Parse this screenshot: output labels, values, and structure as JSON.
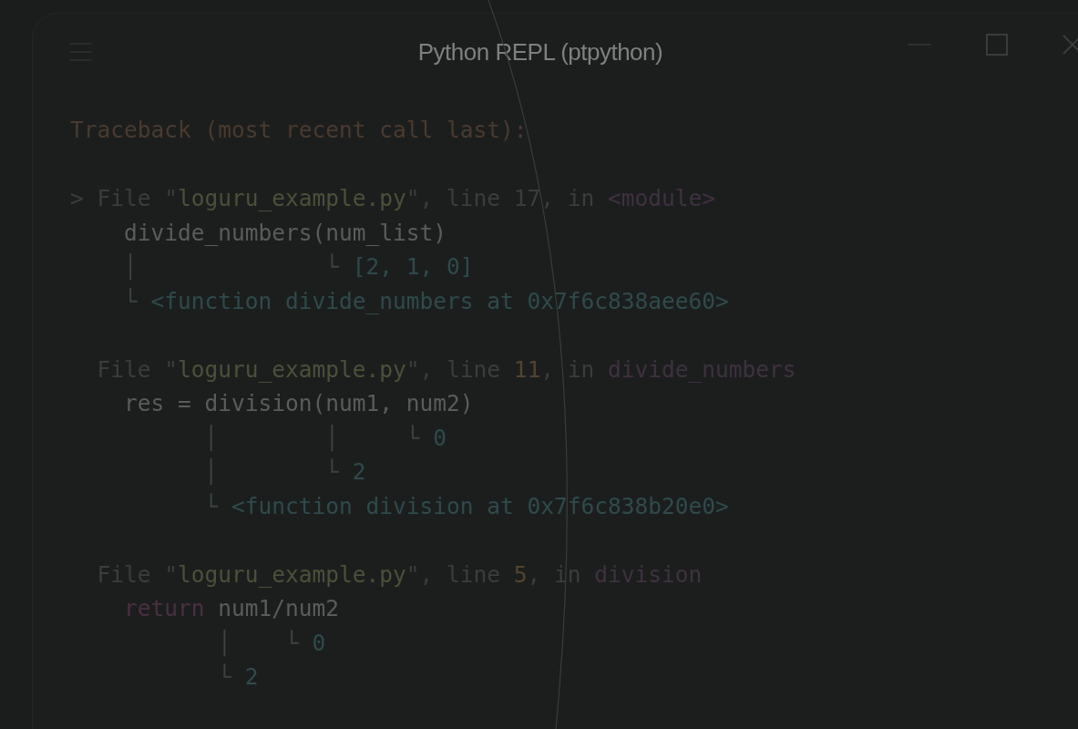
{
  "window": {
    "title": "Python REPL (ptpython)"
  },
  "traceback": {
    "header": "Traceback (most recent call last):",
    "frames": [
      {
        "lines": [
          [
            {
              "t": "> File \"",
              "kind": "dim"
            },
            {
              "t": "loguru_example.py",
              "kind": "path"
            },
            {
              "t": "\", line ",
              "kind": "dim"
            },
            {
              "t": "17",
              "kind": "dim"
            },
            {
              "t": ", in ",
              "kind": "dim"
            },
            {
              "t": "<module>",
              "kind": "func"
            }
          ],
          [
            {
              "t": "    divide_numbers(num_list)",
              "kind": "code"
            }
          ],
          [
            {
              "t": "    │              └ ",
              "kind": "tree"
            },
            {
              "t": "[2, 1, 0]",
              "kind": "value"
            }
          ],
          [
            {
              "t": "    └ ",
              "kind": "tree"
            },
            {
              "t": "<function divide_numbers at 0x7f6c838aee60>",
              "kind": "value"
            }
          ]
        ]
      },
      {
        "lines": [
          [
            {
              "t": "  File \"",
              "kind": "dim"
            },
            {
              "t": "loguru_example.py",
              "kind": "path"
            },
            {
              "t": "\", line ",
              "kind": "dim"
            },
            {
              "t": "11",
              "kind": "lineno"
            },
            {
              "t": ", in ",
              "kind": "dim"
            },
            {
              "t": "divide_numbers",
              "kind": "func"
            }
          ],
          [
            {
              "t": "    res = division(num1, num2)",
              "kind": "code"
            }
          ],
          [
            {
              "t": "          │        │     └ ",
              "kind": "tree"
            },
            {
              "t": "0",
              "kind": "value"
            }
          ],
          [
            {
              "t": "          │        └ ",
              "kind": "tree"
            },
            {
              "t": "2",
              "kind": "value"
            }
          ],
          [
            {
              "t": "          └ ",
              "kind": "tree"
            },
            {
              "t": "<function division at 0x7f6c838b20e0>",
              "kind": "value"
            }
          ]
        ]
      },
      {
        "lines": [
          [
            {
              "t": "  File \"",
              "kind": "dim"
            },
            {
              "t": "loguru_example.py",
              "kind": "path"
            },
            {
              "t": "\", line ",
              "kind": "dim"
            },
            {
              "t": "5",
              "kind": "lineno"
            },
            {
              "t": ", in ",
              "kind": "dim"
            },
            {
              "t": "division",
              "kind": "func"
            }
          ],
          [
            {
              "t": "    return",
              "kind": "keyword"
            },
            {
              "t": " num1/num2",
              "kind": "code"
            }
          ],
          [
            {
              "t": "           │    └ ",
              "kind": "tree"
            },
            {
              "t": "0",
              "kind": "value"
            }
          ],
          [
            {
              "t": "           └ ",
              "kind": "tree"
            },
            {
              "t": "2",
              "kind": "value"
            }
          ]
        ]
      }
    ]
  }
}
